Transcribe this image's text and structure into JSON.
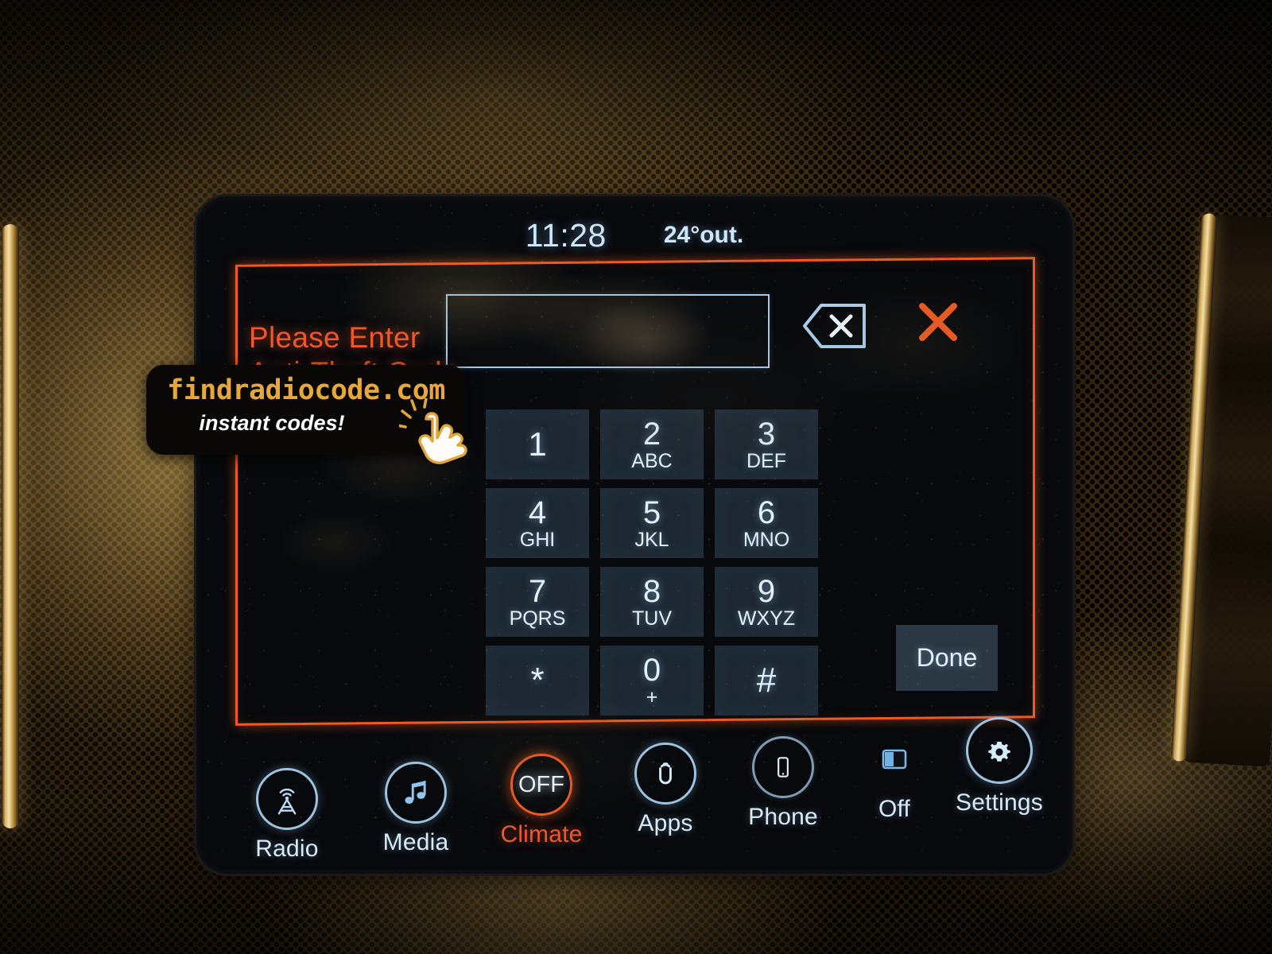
{
  "statusbar": {
    "clock": "11:28",
    "temperature": "24°out."
  },
  "antitheft": {
    "prompt_line1": "Please Enter",
    "prompt_line2": "Anti-Theft Code",
    "code_value": "",
    "code_placeholder": "",
    "backspace_icon": "backspace-icon",
    "close_icon": "close-icon",
    "done_label": "Done",
    "border_color": "#ef5a22",
    "prompt_color": "#f0572a"
  },
  "keypad": {
    "keys": [
      {
        "digit": "1",
        "letters": ""
      },
      {
        "digit": "2",
        "letters": "ABC"
      },
      {
        "digit": "3",
        "letters": "DEF"
      },
      {
        "digit": "4",
        "letters": "GHI"
      },
      {
        "digit": "5",
        "letters": "JKL"
      },
      {
        "digit": "6",
        "letters": "MNO"
      },
      {
        "digit": "7",
        "letters": "PQRS"
      },
      {
        "digit": "8",
        "letters": "TUV"
      },
      {
        "digit": "9",
        "letters": "WXYZ"
      },
      {
        "digit": "*",
        "letters": ""
      },
      {
        "digit": "0",
        "letters": "+"
      },
      {
        "digit": "#",
        "letters": ""
      }
    ]
  },
  "navbar": {
    "items": [
      {
        "label": "Radio",
        "icon": "radio-tower-icon"
      },
      {
        "label": "Media",
        "icon": "music-note-icon"
      },
      {
        "label": "Climate",
        "icon": "climate-off-icon",
        "state": "OFF"
      },
      {
        "label": "Apps",
        "icon": "uconnect-apps-icon"
      },
      {
        "label": "Phone",
        "icon": "phone-icon"
      },
      {
        "label": "Off",
        "icon": "screen-off-icon"
      },
      {
        "label": "Settings",
        "icon": "gear-icon"
      }
    ],
    "accent_color": "#ef5a22",
    "icon_color": "#9fc4e0"
  },
  "watermark": {
    "url": "findradiocode.com",
    "tagline": "instant codes!",
    "icon": "tapping-hand-icon",
    "url_color": "#e6a83a"
  }
}
